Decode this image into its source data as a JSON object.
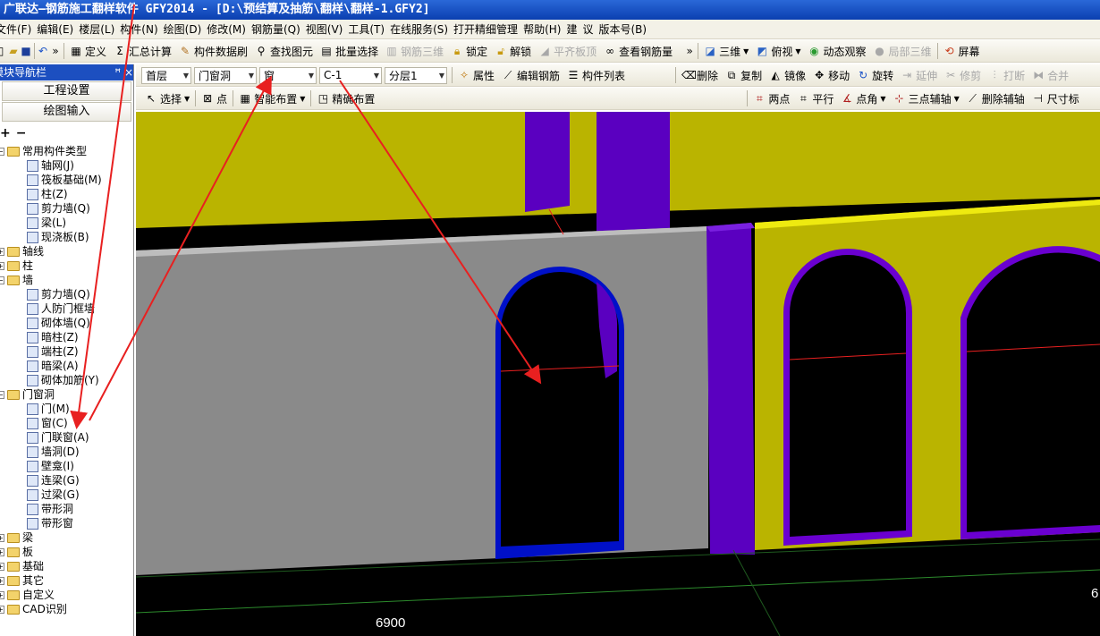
{
  "window": {
    "title": "广联达—钢筋施工翻样软件 GFY2014 - [D:\\预结算及抽筋\\翻样\\翻样-1.GFY2]"
  },
  "menu": [
    "文件(F)",
    "编辑(E)",
    "楼层(L)",
    "构件(N)",
    "绘图(D)",
    "修改(M)",
    "钢筋量(Q)",
    "视图(V)",
    "工具(T)",
    "在线服务(S)",
    "打开精细管理",
    "帮助(H)",
    "建",
    "议",
    "版本号(B)"
  ],
  "toolbar1": {
    "define": "定义",
    "sum": "汇总计算",
    "component_brush": "构件数据刷",
    "find_element": "查找图元",
    "batch_select": "批量选择",
    "rebar_3d": "钢筋三维",
    "lock": "锁定",
    "unlock": "解锁",
    "flat_slab": "平齐板顶",
    "view_rebar": "查看钢筋量",
    "view3d": "三维",
    "top_view": "俯视",
    "dynamic_view": "动态观察",
    "local_3d": "局部三维",
    "screen": "屏幕"
  },
  "nav": {
    "title": "模块导航栏",
    "pin": "ꟸ",
    "close": "×",
    "project_settings": "工程设置",
    "drawing_input": "绘图输入"
  },
  "selectors": {
    "floor": "首层",
    "category": "门窗洞",
    "type": "窗",
    "element": "C-1",
    "layer": "分层1"
  },
  "toolbar2": {
    "properties": "属性",
    "edit_rebar": "编辑钢筋",
    "component_list": "构件列表",
    "delete": "删除",
    "copy": "复制",
    "mirror": "镜像",
    "move": "移动",
    "rotate": "旋转",
    "extend": "延伸",
    "trim": "修剪",
    "break": "打断",
    "merge": "合并"
  },
  "toolbar3": {
    "select": "选择",
    "point": "点",
    "smart_place": "智能布置",
    "precise_place": "精确布置",
    "two_points": "两点",
    "parallel": "平行",
    "point_angle": "点角",
    "three_point_axis": "三点辅轴",
    "delete_axis": "删除辅轴",
    "dimension": "尺寸标"
  },
  "tree": {
    "common": "常用构件类型",
    "common_items": [
      "轴网(J)",
      "筏板基础(M)",
      "柱(Z)",
      "剪力墙(Q)",
      "梁(L)",
      "现浇板(B)"
    ],
    "axis": "轴线",
    "column": "柱",
    "wall": "墙",
    "wall_items": [
      "剪力墙(Q)",
      "人防门框墙",
      "砌体墙(Q)",
      "暗柱(Z)",
      "端柱(Z)",
      "暗梁(A)",
      "砌体加筋(Y)"
    ],
    "openings": "门窗洞",
    "opening_items": [
      "门(M)",
      "窗(C)",
      "门联窗(A)",
      "墙洞(D)",
      "壁龛(I)",
      "连梁(G)",
      "过梁(G)",
      "带形洞",
      "带形窗"
    ],
    "beam": "梁",
    "slab": "板",
    "foundation": "基础",
    "other": "其它",
    "custom": "自定义",
    "cad": "CAD识别"
  },
  "viewport": {
    "dim1": "6900",
    "dim2": "6",
    "colors": {
      "wall_yellow": "#bab400",
      "column_purple": "#5a00c0",
      "grey_wall": "#8a8a8a",
      "opening_blue": "#0010c8",
      "arrow_red": "#e82020"
    }
  }
}
